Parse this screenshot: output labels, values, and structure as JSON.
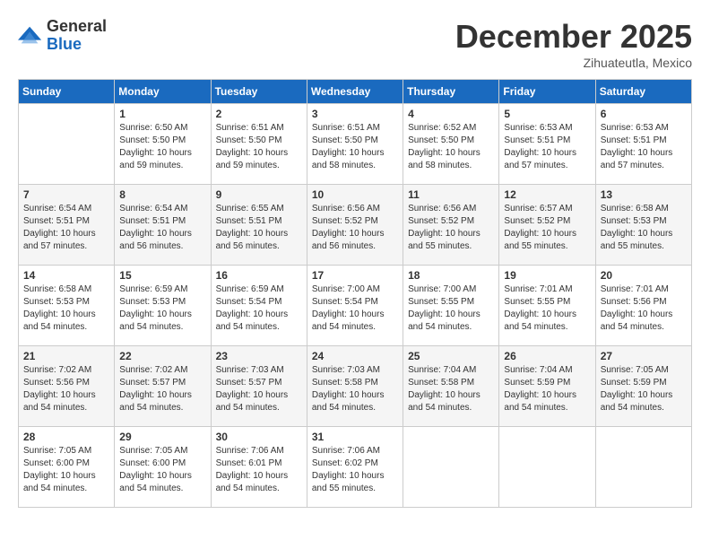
{
  "header": {
    "logo": {
      "general": "General",
      "blue": "Blue"
    },
    "title": "December 2025",
    "location": "Zihuateutla, Mexico"
  },
  "weekdays": [
    "Sunday",
    "Monday",
    "Tuesday",
    "Wednesday",
    "Thursday",
    "Friday",
    "Saturday"
  ],
  "weeks": [
    [
      {
        "day": null
      },
      {
        "day": "1",
        "sunrise": "6:50 AM",
        "sunset": "5:50 PM",
        "daylight": "10 hours and 59 minutes."
      },
      {
        "day": "2",
        "sunrise": "6:51 AM",
        "sunset": "5:50 PM",
        "daylight": "10 hours and 59 minutes."
      },
      {
        "day": "3",
        "sunrise": "6:51 AM",
        "sunset": "5:50 PM",
        "daylight": "10 hours and 58 minutes."
      },
      {
        "day": "4",
        "sunrise": "6:52 AM",
        "sunset": "5:50 PM",
        "daylight": "10 hours and 58 minutes."
      },
      {
        "day": "5",
        "sunrise": "6:53 AM",
        "sunset": "5:51 PM",
        "daylight": "10 hours and 57 minutes."
      },
      {
        "day": "6",
        "sunrise": "6:53 AM",
        "sunset": "5:51 PM",
        "daylight": "10 hours and 57 minutes."
      }
    ],
    [
      {
        "day": "7",
        "sunrise": "6:54 AM",
        "sunset": "5:51 PM",
        "daylight": "10 hours and 57 minutes."
      },
      {
        "day": "8",
        "sunrise": "6:54 AM",
        "sunset": "5:51 PM",
        "daylight": "10 hours and 56 minutes."
      },
      {
        "day": "9",
        "sunrise": "6:55 AM",
        "sunset": "5:51 PM",
        "daylight": "10 hours and 56 minutes."
      },
      {
        "day": "10",
        "sunrise": "6:56 AM",
        "sunset": "5:52 PM",
        "daylight": "10 hours and 56 minutes."
      },
      {
        "day": "11",
        "sunrise": "6:56 AM",
        "sunset": "5:52 PM",
        "daylight": "10 hours and 55 minutes."
      },
      {
        "day": "12",
        "sunrise": "6:57 AM",
        "sunset": "5:52 PM",
        "daylight": "10 hours and 55 minutes."
      },
      {
        "day": "13",
        "sunrise": "6:58 AM",
        "sunset": "5:53 PM",
        "daylight": "10 hours and 55 minutes."
      }
    ],
    [
      {
        "day": "14",
        "sunrise": "6:58 AM",
        "sunset": "5:53 PM",
        "daylight": "10 hours and 54 minutes."
      },
      {
        "day": "15",
        "sunrise": "6:59 AM",
        "sunset": "5:53 PM",
        "daylight": "10 hours and 54 minutes."
      },
      {
        "day": "16",
        "sunrise": "6:59 AM",
        "sunset": "5:54 PM",
        "daylight": "10 hours and 54 minutes."
      },
      {
        "day": "17",
        "sunrise": "7:00 AM",
        "sunset": "5:54 PM",
        "daylight": "10 hours and 54 minutes."
      },
      {
        "day": "18",
        "sunrise": "7:00 AM",
        "sunset": "5:55 PM",
        "daylight": "10 hours and 54 minutes."
      },
      {
        "day": "19",
        "sunrise": "7:01 AM",
        "sunset": "5:55 PM",
        "daylight": "10 hours and 54 minutes."
      },
      {
        "day": "20",
        "sunrise": "7:01 AM",
        "sunset": "5:56 PM",
        "daylight": "10 hours and 54 minutes."
      }
    ],
    [
      {
        "day": "21",
        "sunrise": "7:02 AM",
        "sunset": "5:56 PM",
        "daylight": "10 hours and 54 minutes."
      },
      {
        "day": "22",
        "sunrise": "7:02 AM",
        "sunset": "5:57 PM",
        "daylight": "10 hours and 54 minutes."
      },
      {
        "day": "23",
        "sunrise": "7:03 AM",
        "sunset": "5:57 PM",
        "daylight": "10 hours and 54 minutes."
      },
      {
        "day": "24",
        "sunrise": "7:03 AM",
        "sunset": "5:58 PM",
        "daylight": "10 hours and 54 minutes."
      },
      {
        "day": "25",
        "sunrise": "7:04 AM",
        "sunset": "5:58 PM",
        "daylight": "10 hours and 54 minutes."
      },
      {
        "day": "26",
        "sunrise": "7:04 AM",
        "sunset": "5:59 PM",
        "daylight": "10 hours and 54 minutes."
      },
      {
        "day": "27",
        "sunrise": "7:05 AM",
        "sunset": "5:59 PM",
        "daylight": "10 hours and 54 minutes."
      }
    ],
    [
      {
        "day": "28",
        "sunrise": "7:05 AM",
        "sunset": "6:00 PM",
        "daylight": "10 hours and 54 minutes."
      },
      {
        "day": "29",
        "sunrise": "7:05 AM",
        "sunset": "6:00 PM",
        "daylight": "10 hours and 54 minutes."
      },
      {
        "day": "30",
        "sunrise": "7:06 AM",
        "sunset": "6:01 PM",
        "daylight": "10 hours and 54 minutes."
      },
      {
        "day": "31",
        "sunrise": "7:06 AM",
        "sunset": "6:02 PM",
        "daylight": "10 hours and 55 minutes."
      },
      {
        "day": null
      },
      {
        "day": null
      },
      {
        "day": null
      }
    ]
  ]
}
